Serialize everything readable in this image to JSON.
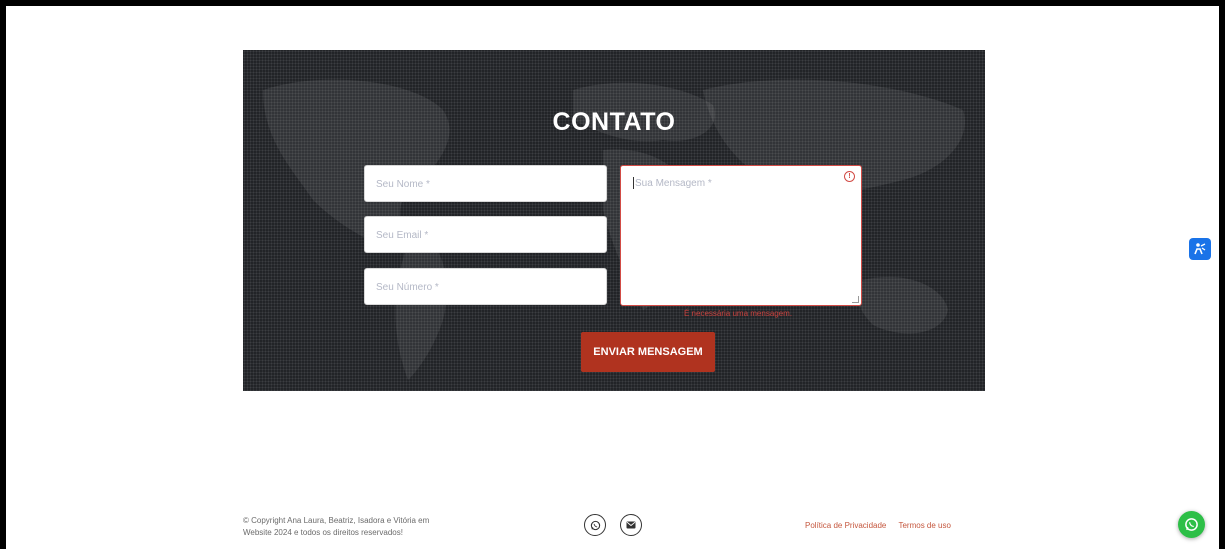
{
  "contact": {
    "title": "CONTATO",
    "name_placeholder": "Seu Nome *",
    "email_placeholder": "Seu Email *",
    "phone_placeholder": "Seu Número *",
    "message_placeholder": "Sua Mensagem *",
    "error_message": "É necessária uma mensagem.",
    "submit_label": "ENVIAR MENSAGEM"
  },
  "footer": {
    "copyright_line1": "© Copyright Ana Laura, Beatriz, Isadora e Vitória em",
    "copyright_line2": "Website 2024 e todos os direitos reservados!",
    "privacy_link": "Política de Privacidade",
    "terms_link": "Termos de uso"
  },
  "icons": {
    "social": [
      "whatsapp-icon",
      "mail-icon"
    ],
    "floating": [
      "accessibility-icon",
      "whatsapp-icon"
    ],
    "error": "warning-icon"
  },
  "colors": {
    "section_bg": "#202226",
    "accent": "#b0331f",
    "error": "#d24b45",
    "whatsapp": "#2dbf47",
    "accessibility": "#1a73e8"
  }
}
